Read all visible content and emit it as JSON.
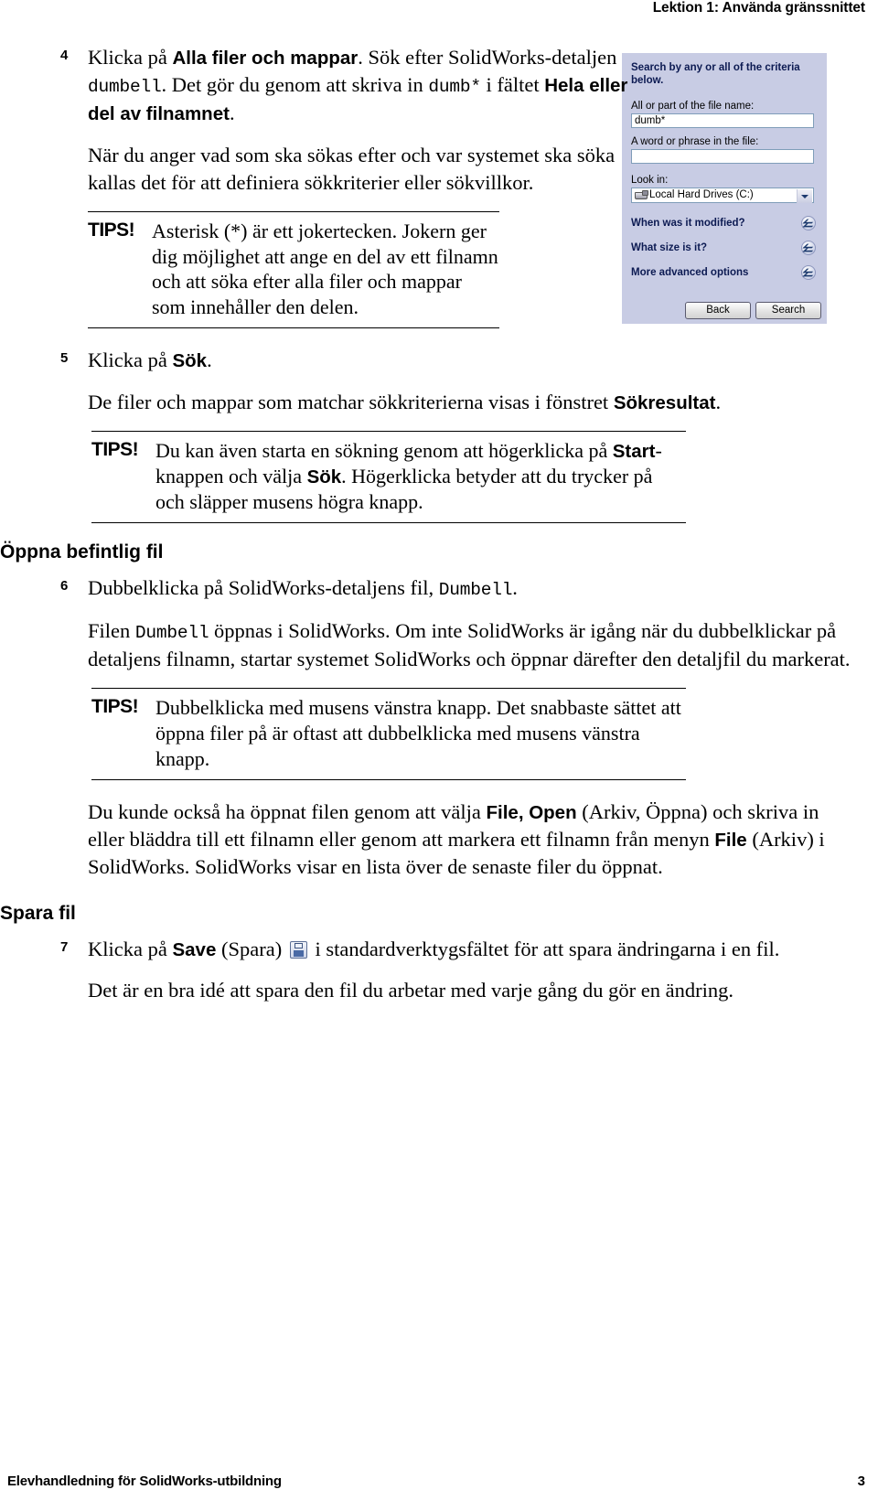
{
  "header": {
    "running_head": "Lektion 1: Använda gränssnittet"
  },
  "footer": {
    "left": "Elevhandledning för SolidWorks-utbildning",
    "page_number": "3"
  },
  "steps": {
    "s4": {
      "num": "4",
      "line_a": "Klicka på ",
      "bold_a": "Alla filer och mappar",
      "line_b": ". Sök efter SolidWorks-detaljen ",
      "mono_a": "dumbell",
      "line_c": ". Det gör du genom att skriva in ",
      "mono_b": "dumb*",
      "line_d": " i fältet ",
      "bold_b": "Hela eller del av filnamnet",
      "line_e": ".",
      "para2": "När du anger vad som ska sökas efter och var systemet ska söka kallas det för att definiera sökkriterier eller sökvillkor."
    },
    "s5": {
      "num": "5",
      "line_a": "Klicka på ",
      "bold_a": "Sök",
      "line_b": ".",
      "para2_a": "De filer och mappar som matchar sökkriterierna visas i fönstret ",
      "para2_bold": "Sökresultat",
      "para2_b": "."
    },
    "s6": {
      "num": "6",
      "line_a": "Dubbelklicka på SolidWorks-detaljens fil, ",
      "mono_a": "Dumbell",
      "line_b": ".",
      "para2_a": "Filen ",
      "para2_mono": "Dumbell",
      "para2_b": " öppnas i SolidWorks. Om inte SolidWorks är igång när du dubbelklickar på detaljens filnamn, startar systemet SolidWorks och öppnar därefter den detaljfil du markerat."
    },
    "s7": {
      "num": "7",
      "line_a": "Klicka på ",
      "bold_a": "Save",
      "line_b": " (Spara) ",
      "icon": "save-floppy-icon",
      "line_c": " i standardverktygsfältet för att spara ändringarna i en fil.",
      "para2": "Det är en bra idé att spara den fil du arbetar med varje gång du gör en ändring."
    }
  },
  "tips": {
    "tip1": {
      "label": "TIPS!",
      "text": "Asterisk (*) är ett jokertecken. Jokern ger dig möjlighet att ange en del av ett filnamn och att söka efter alla filer och mappar som innehåller den delen."
    },
    "tip2": {
      "label": "TIPS!",
      "text_a": "Du kan även starta en sökning genom att högerklicka på ",
      "bold_a": "Start",
      "text_b": "-knappen och välja ",
      "bold_b": "Sök",
      "text_c": ". Högerklicka betyder att du trycker på och släpper musens högra knapp."
    },
    "tip3": {
      "label": "TIPS!",
      "text": "Dubbelklicka med musens vänstra knapp. Det snabbaste sättet att öppna filer på är oftast att dubbelklicka med musens vänstra knapp."
    }
  },
  "sections": {
    "open_existing": "Öppna befintlig fil",
    "save_file": "Spara fil"
  },
  "closing_paragraph": {
    "text_a": "Du kunde också ha öppnat filen genom att välja ",
    "bold_a": "File, Open",
    "text_b": " (Arkiv, Öppna) och skriva in eller bläddra till ett filnamn eller genom att markera ett filnamn från menyn ",
    "bold_b": "File",
    "text_c": " (Arkiv) i SolidWorks. SolidWorks visar en lista över de senaste filer du öppnat."
  },
  "search_panel": {
    "title": "Search by any or all of the criteria below.",
    "label_filename": "All or part of the file name:",
    "value_filename": "dumb*",
    "label_phrase": "A word or phrase in the file:",
    "value_phrase": "",
    "label_lookin": "Look in:",
    "value_lookin": "Local Hard Drives (C:)",
    "section_modified": "When was it modified?",
    "section_size": "What size is it?",
    "section_advanced": "More advanced options",
    "button_back": "Back",
    "button_search": "Search",
    "colors": {
      "panel_bg": "#c8cce4",
      "heading": "#0c1a52",
      "field_border": "#7f9db9"
    }
  }
}
